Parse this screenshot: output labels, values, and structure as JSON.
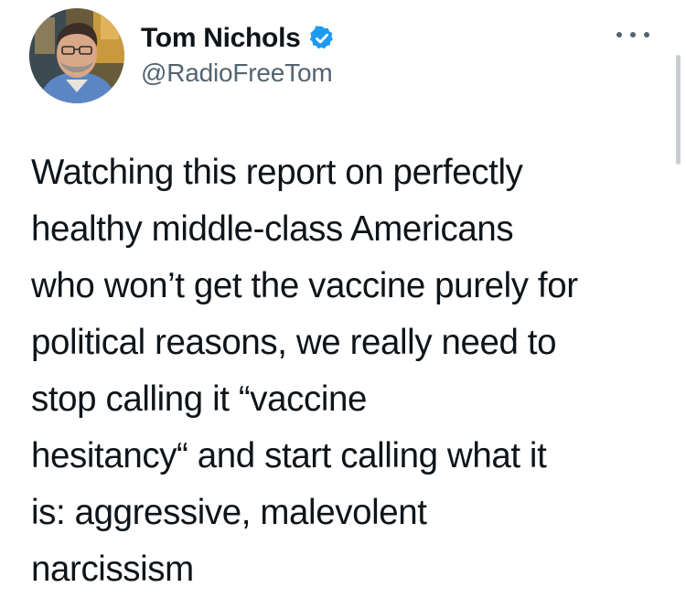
{
  "author": {
    "display_name": "Tom Nichols",
    "handle": "@RadioFreeTom",
    "verified": true,
    "avatar_icon": "profile-photo"
  },
  "menu": {
    "icon": "more-options-icon"
  },
  "tweet": {
    "lines": [
      "Watching this report on perfectly",
      "healthy middle-class Americans",
      "who won’t get the vaccine purely for",
      "political reasons, we really need to",
      "stop calling it “vaccine",
      "hesitancy“ and start calling what it",
      "is: aggressive, malevolent",
      "narcissism"
    ]
  },
  "colors": {
    "text": "#0f1419",
    "secondary": "#536471",
    "verified_badge": "#1d9bf0",
    "background": "#ffffff"
  }
}
